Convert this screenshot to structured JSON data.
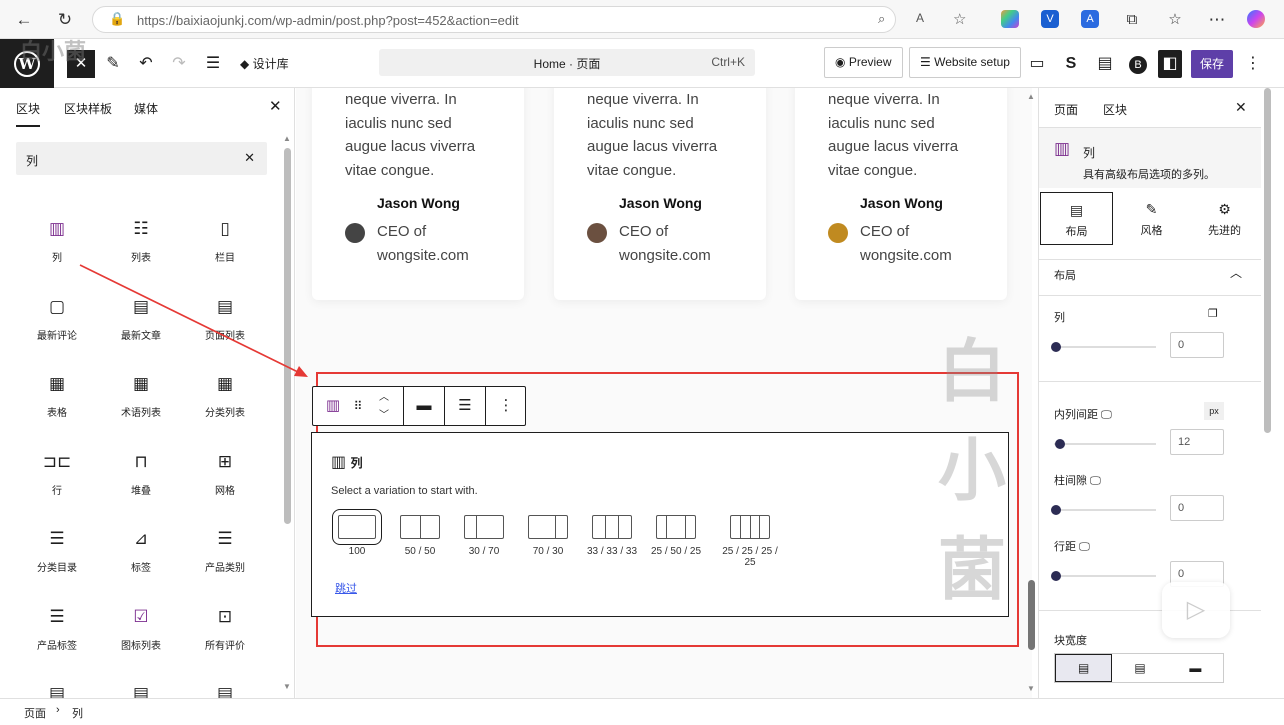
{
  "browser": {
    "url": "https://baixiaojunkj.com/wp-admin/post.php?post=452&action=edit"
  },
  "toolbar": {
    "design_library": "设计库",
    "command": "Home · 页面",
    "shortcut": "Ctrl+K",
    "preview": "Preview",
    "website_setup": "Website setup",
    "save": "保存"
  },
  "left_panel": {
    "tabs": [
      "区块",
      "区块样板",
      "媒体"
    ],
    "search_value": "列",
    "blocks": [
      {
        "label": "列",
        "icon": "columns-icon"
      },
      {
        "label": "列表",
        "icon": "list-icon"
      },
      {
        "label": "栏目",
        "icon": "column-icon"
      },
      {
        "label": "最新评论",
        "icon": "comment-icon"
      },
      {
        "label": "最新文章",
        "icon": "posts-icon"
      },
      {
        "label": "页面列表",
        "icon": "page-list-icon"
      },
      {
        "label": "表格",
        "icon": "table-icon"
      },
      {
        "label": "术语列表",
        "icon": "terms-icon"
      },
      {
        "label": "分类列表",
        "icon": "categories-icon"
      },
      {
        "label": "行",
        "icon": "row-icon"
      },
      {
        "label": "堆叠",
        "icon": "stack-icon"
      },
      {
        "label": "网格",
        "icon": "grid-icon"
      },
      {
        "label": "分类目录",
        "icon": "category-dir-icon"
      },
      {
        "label": "标签",
        "icon": "tag-icon"
      },
      {
        "label": "产品类别",
        "icon": "product-cat-icon"
      },
      {
        "label": "产品标签",
        "icon": "product-tag-icon"
      },
      {
        "label": "图标列表",
        "icon": "icon-list-icon"
      },
      {
        "label": "所有评价",
        "icon": "reviews-icon"
      }
    ]
  },
  "cards": [
    {
      "text": [
        "neque viverra. In",
        "iaculis nunc sed",
        "augue lacus viverra",
        "vitae congue."
      ],
      "name": "Jason Wong",
      "role": [
        "CEO of",
        "wongsite.com"
      ]
    },
    {
      "text": [
        "neque viverra. In",
        "iaculis nunc sed",
        "augue lacus viverra",
        "vitae congue."
      ],
      "name": "Jason Wong",
      "role": [
        "CEO of",
        "wongsite.com"
      ]
    },
    {
      "text": [
        "neque viverra. In",
        "iaculis nunc sed",
        "augue lacus viverra",
        "vitae congue."
      ],
      "name": "Jason Wong",
      "role": [
        "CEO of",
        "wongsite.com"
      ]
    }
  ],
  "placeholder": {
    "title": "列",
    "instructions": "Select a variation to start with.",
    "variations": [
      "100",
      "50 / 50",
      "30 / 70",
      "70 / 30",
      "33 / 33 / 33",
      "25 / 50 / 25",
      "25 / 25 / 25 / 25"
    ],
    "skip": "跳过"
  },
  "right_panel": {
    "tabs": [
      "页面",
      "区块"
    ],
    "block_title": "列",
    "block_desc": "具有高级布局选项的多列。",
    "sub_tabs": [
      "布局",
      "风格",
      "先进的"
    ],
    "section": "布局",
    "columns_label": "列",
    "columns_value": "0",
    "inner_gap_label": "内列间距",
    "unit": "px",
    "inner_gap_value": "12",
    "col_gap_label": "柱间隙",
    "col_gap_value": "0",
    "row_gap_label": "行距",
    "row_gap_value": "0",
    "block_width_label": "块宽度"
  },
  "footer": {
    "crumbs": [
      "页面",
      "列"
    ]
  },
  "watermarks": {
    "top": "白小菌",
    "right": "白小菌"
  }
}
